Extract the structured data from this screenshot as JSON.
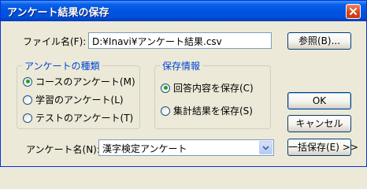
{
  "window": {
    "title": "アンケート結果の保存"
  },
  "file": {
    "label": "ファイル名(F):",
    "value": "D:¥Inavi¥アンケート結果.csv",
    "browse_label": "参照(B)..."
  },
  "survey_type": {
    "title": "アンケートの種類",
    "options": [
      {
        "label": "コースのアンケート(M)",
        "selected": true
      },
      {
        "label": "学習のアンケート(L)",
        "selected": false
      },
      {
        "label": "テストのアンケート(T)",
        "selected": false
      }
    ]
  },
  "save_info": {
    "title": "保存情報",
    "options": [
      {
        "label": "回答内容を保存(C)",
        "selected": true
      },
      {
        "label": "集計結果を保存(S)",
        "selected": false
      }
    ]
  },
  "buttons": {
    "ok": "OK",
    "cancel": "キャンセル",
    "bulk_save": "一括保存(E) >>"
  },
  "survey_name": {
    "label": "アンケート名(N):",
    "value": "漢字検定アンケート"
  },
  "colors": {
    "titlebar": "#0054E3",
    "group_title": "#0046D5",
    "radio_dot": "#21A121",
    "face": "#ECE9D8"
  }
}
